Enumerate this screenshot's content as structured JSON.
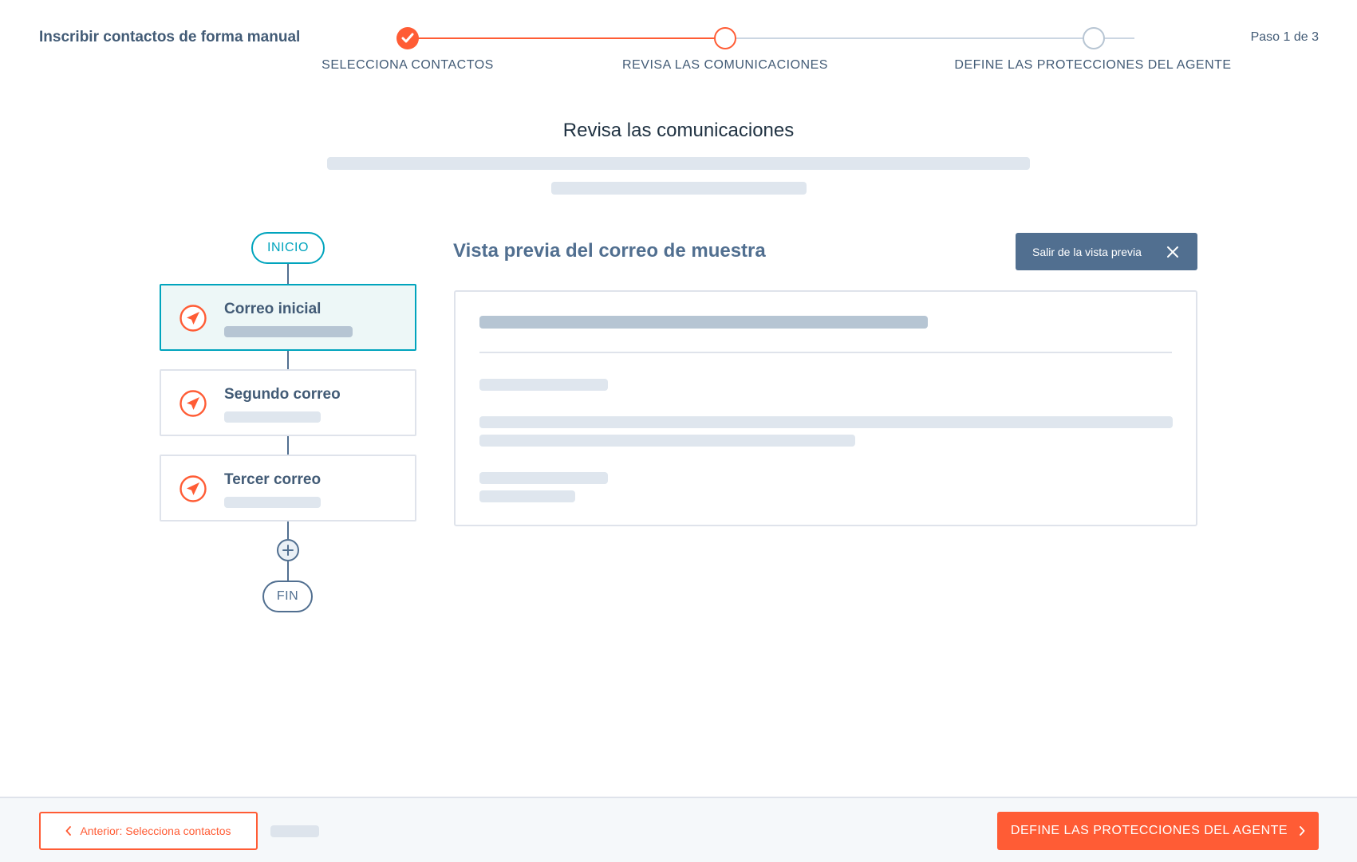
{
  "header": {
    "title": "Inscribir contactos de forma manual",
    "step_counter": "Paso 1 de 3"
  },
  "stepper": {
    "steps": [
      {
        "label": "SELECCIONA CONTACTOS",
        "state": "completed"
      },
      {
        "label": "REVISA LAS COMUNICACIONES",
        "state": "active"
      },
      {
        "label": "DEFINE LAS PROTECCIONES DEL AGENTE",
        "state": "pending"
      }
    ]
  },
  "main": {
    "title": "Revisa las comunicaciones"
  },
  "flow": {
    "start_label": "INICIO",
    "end_label": "FIN",
    "add_icon": "plus-icon",
    "step_icon": "send-icon",
    "items": [
      {
        "title": "Correo inicial",
        "selected": true
      },
      {
        "title": "Segundo correo",
        "selected": false
      },
      {
        "title": "Tercer correo",
        "selected": false
      }
    ]
  },
  "preview": {
    "title": "Vista previa del correo de muestra",
    "exit_label": "Salir de la vista previa",
    "exit_icon": "close-icon"
  },
  "footer": {
    "back_label": "Anterior: Selecciona contactos",
    "back_icon": "chevron-left-icon",
    "next_label": "DEFINE LAS PROTECCIONES DEL AGENTE",
    "next_icon": "chevron-right-icon"
  },
  "colors": {
    "accent": "#ff5c35",
    "teal": "#00a4bd",
    "slate": "#516f90",
    "text": "#425b76"
  }
}
